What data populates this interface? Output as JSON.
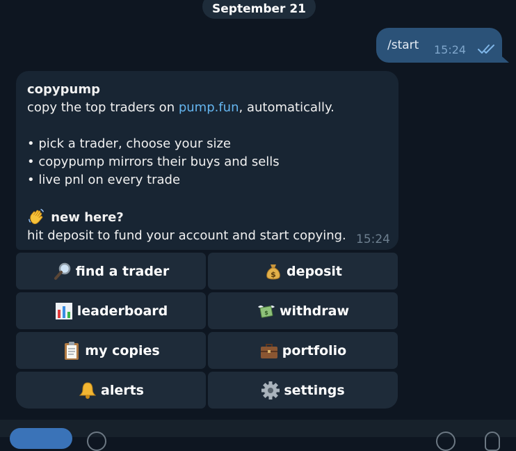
{
  "chat": {
    "date_separator": "September 21",
    "outgoing": {
      "text": "/start",
      "time": "15:24",
      "status_icon": "double-check-icon"
    },
    "incoming": {
      "title": "copypump",
      "intro_before_link": "copy the top traders on ",
      "intro_link": "pump.fun",
      "intro_after_link": ", automatically.",
      "bullets": [
        "•  pick a trader, choose your size",
        "•  copypump mirrors their buys and sells",
        "•  live pnl on every trade"
      ],
      "new_here": "new here?",
      "new_here_emoji": "waving-hand-icon",
      "closing": "hit deposit to fund your account and start copying.",
      "time": "15:24"
    }
  },
  "keyboard": {
    "buttons": [
      {
        "label": "find a trader",
        "icon": "magnifier-icon"
      },
      {
        "label": "deposit",
        "icon": "money-bag-icon"
      },
      {
        "label": "leaderboard",
        "icon": "bar-chart-icon"
      },
      {
        "label": "withdraw",
        "icon": "flying-money-icon"
      },
      {
        "label": "my copies",
        "icon": "clipboard-icon"
      },
      {
        "label": "portfolio",
        "icon": "briefcase-icon"
      },
      {
        "label": "alerts",
        "icon": "bell-icon"
      },
      {
        "label": "settings",
        "icon": "gear-icon"
      }
    ]
  },
  "colors": {
    "background": "#0e1621",
    "outgoing_bubble": "#2b5278",
    "incoming_bubble": "#182533",
    "keyboard_button": "#1e2b39",
    "link": "#64b5ef"
  }
}
